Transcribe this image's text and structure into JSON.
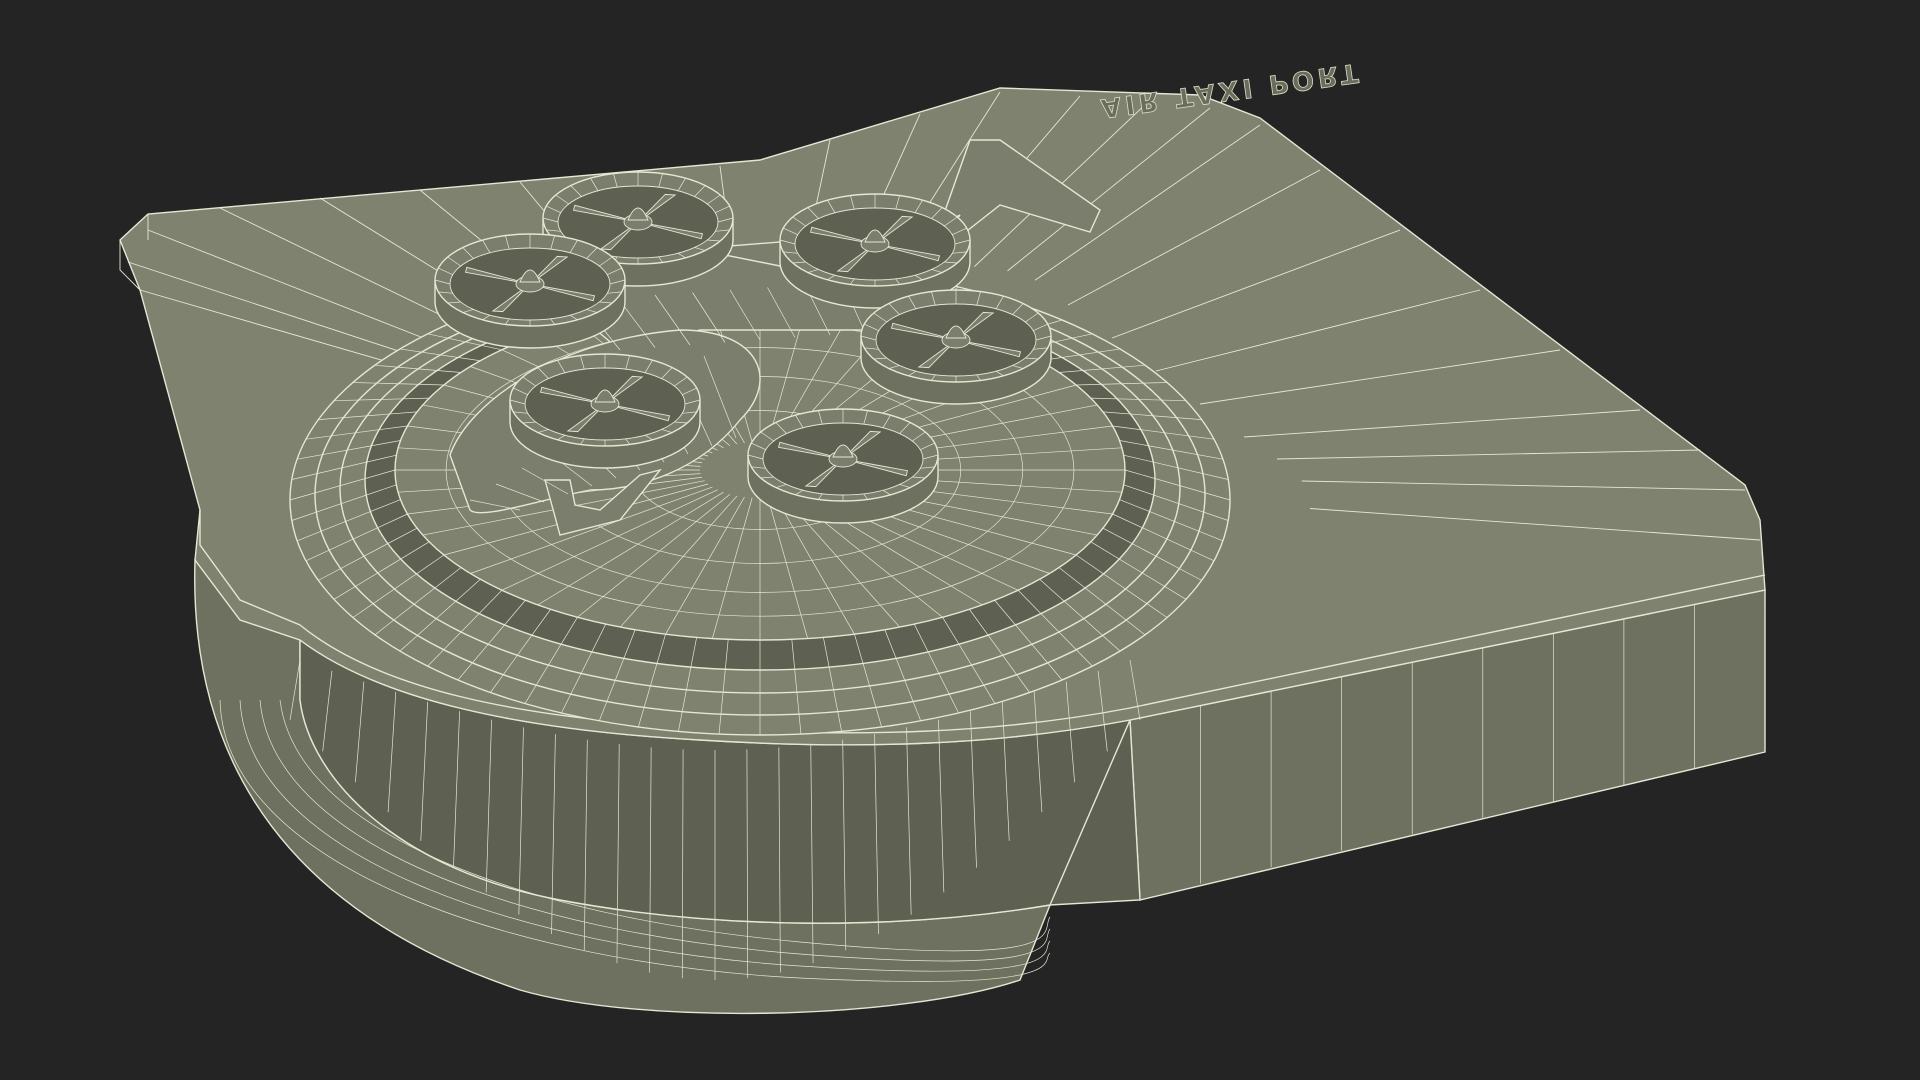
{
  "scene": {
    "background_color": "#242424",
    "model_color": "#7b7e6c",
    "wire_color": "#e6e6d2",
    "sign_text": "AIR TAXI PORT",
    "rotor_count": 6,
    "subject": "air-taxi-port"
  }
}
